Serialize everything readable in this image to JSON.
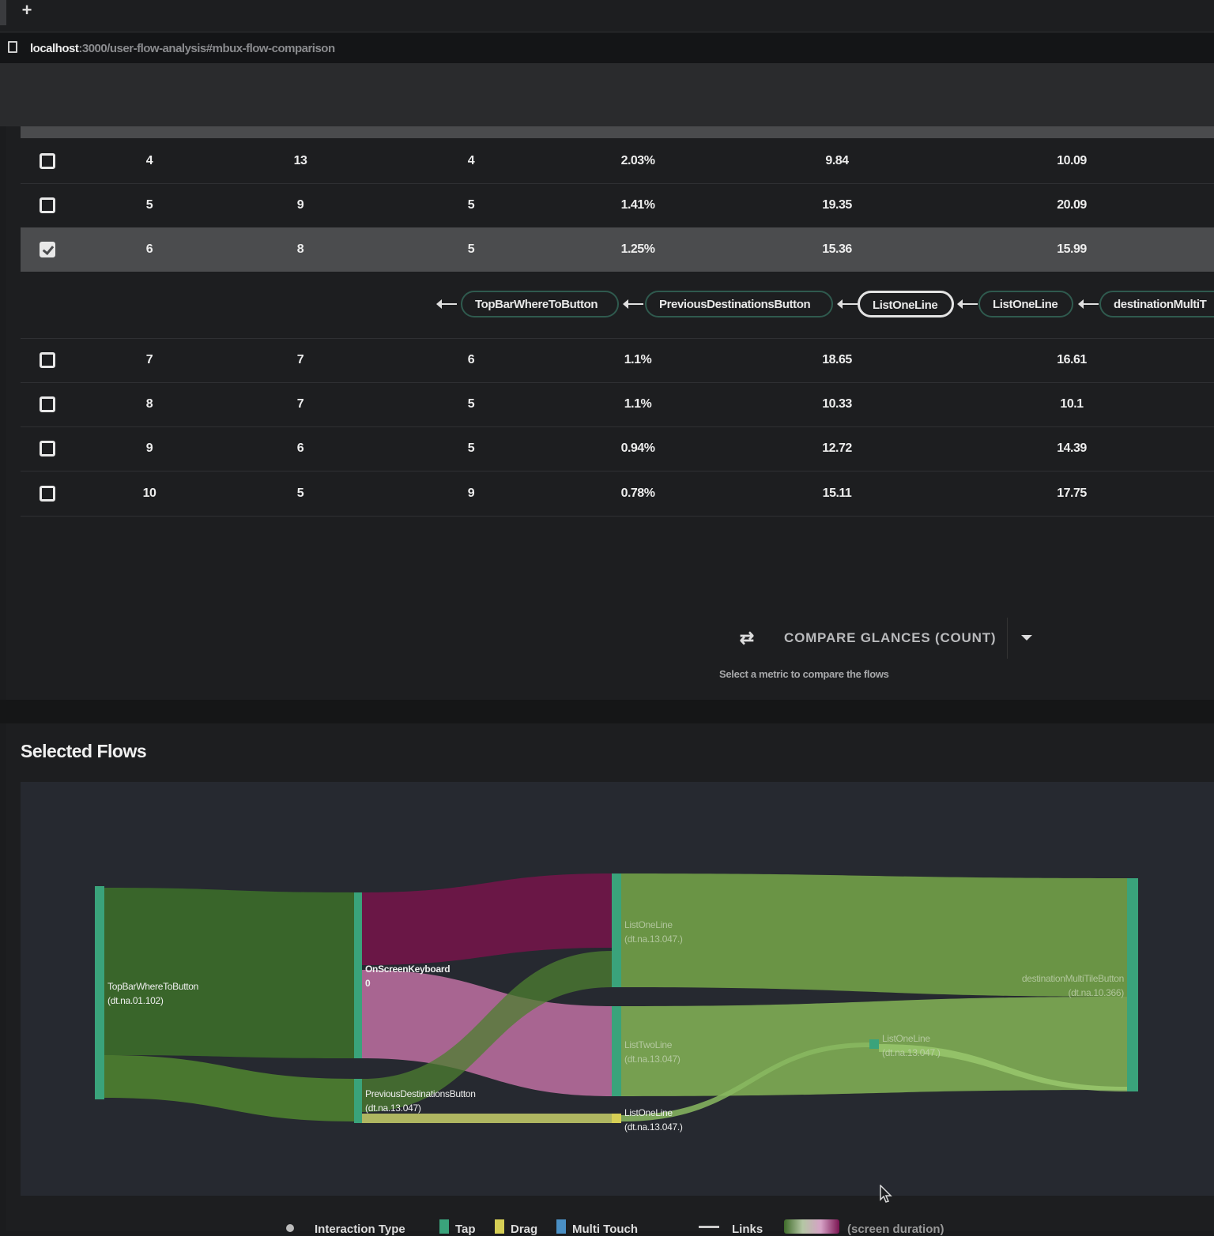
{
  "browser": {
    "url_host": "localhost",
    "url_path": ":3000/user-flow-analysis#mbux-flow-comparison"
  },
  "table": {
    "rows": [
      {
        "index": "4",
        "col2": "13",
        "col3": "4",
        "share": "2.03%",
        "col5": "9.84",
        "col6": "10.09",
        "checked": false
      },
      {
        "index": "5",
        "col2": "9",
        "col3": "5",
        "share": "1.41%",
        "col5": "19.35",
        "col6": "20.09",
        "checked": false
      },
      {
        "index": "6",
        "col2": "8",
        "col3": "5",
        "share": "1.25%",
        "col5": "15.36",
        "col6": "15.99",
        "checked": true
      },
      {
        "index": "7",
        "col2": "7",
        "col3": "6",
        "share": "1.1%",
        "col5": "18.65",
        "col6": "16.61",
        "checked": false
      },
      {
        "index": "8",
        "col2": "7",
        "col3": "5",
        "share": "1.1%",
        "col5": "10.33",
        "col6": "10.1",
        "checked": false
      },
      {
        "index": "9",
        "col2": "6",
        "col3": "5",
        "share": "0.94%",
        "col5": "12.72",
        "col6": "14.39",
        "checked": false
      },
      {
        "index": "10",
        "col2": "5",
        "col3": "9",
        "share": "0.78%",
        "col5": "15.11",
        "col6": "17.75",
        "checked": false
      }
    ],
    "expanded_path": [
      "TopBarWhereToButton",
      "PreviousDestinationsButton",
      "ListOneLine",
      "ListOneLine",
      "destinationMultiT"
    ]
  },
  "compare": {
    "icon": "compare-arrows-icon",
    "label": "COMPARE GLANCES (COUNT)",
    "help": "Select a metric to compare the flows"
  },
  "selected_flows": {
    "title": "Selected Flows",
    "nodes": {
      "n1": {
        "name": "TopBarWhereToButton",
        "sub": "(dt.na.01.102)"
      },
      "n2": {
        "name": "OnScreenKeyboard",
        "sub": "0"
      },
      "n3": {
        "name": "PreviousDestinationsButton",
        "sub": "(dt.na.13.047)"
      },
      "n4": {
        "name": "ListOneLine",
        "sub": "(dt.na.13.047.)"
      },
      "n5": {
        "name": "ListTwoLine",
        "sub": "(dt.na.13.047)"
      },
      "n6": {
        "name": "ListOneLine",
        "sub": "(dt.na.13.047.)"
      },
      "n7": {
        "name": "ListOneLine",
        "sub": "(dt.na.13.047.)"
      },
      "n8": {
        "name": "destinationMultiTileButton",
        "sub": "(dt.na.10.366)"
      }
    },
    "colors": {
      "node": "#3aa37b",
      "link_dark_green": "#3b6a2a",
      "link_mid_green": "#4e7f30",
      "link_light_green": "#7aa552",
      "link_pink": "#b36a9a",
      "link_magenta": "#6e1648",
      "link_yellow": "#c8cf6a"
    }
  },
  "legend": {
    "interaction_type": "Interaction Type",
    "tap": "Tap",
    "drag": "Drag",
    "multitouch": "Multi Touch",
    "links": "Links",
    "links_note": "(screen duration)",
    "tap_color": "#3aa37b",
    "drag_color": "#d6cf55",
    "multitouch_color": "#4a8fc4"
  }
}
